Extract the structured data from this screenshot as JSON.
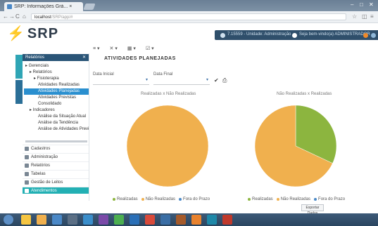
{
  "browser": {
    "tab_title": "SRP: Informações Grá... ×",
    "url_host": "localhost",
    "url_path": "/SRP/app/#",
    "nav": [
      "←",
      "→",
      "C",
      "⌂"
    ]
  },
  "app": {
    "logo_text": "SRP",
    "header_items": [
      "7.15559 - Unidade: Administração",
      "Seja bem-vindo(a) ADMINISTRADOR"
    ]
  },
  "sidebar": {
    "header": "Relatórios",
    "tree": [
      {
        "label": "Gerenciais",
        "indent": 0
      },
      {
        "label": "Relatórios",
        "indent": 1
      },
      {
        "label": "Fisioterapia",
        "indent": 2
      },
      {
        "label": "Atividades Realizadas",
        "indent": 3
      },
      {
        "label": "Atividades Planejadas",
        "indent": 3,
        "selected": true
      },
      {
        "label": "Atividades Previstas",
        "indent": 3
      },
      {
        "label": "Consolidado",
        "indent": 3
      },
      {
        "label": "Indicadores",
        "indent": 1
      },
      {
        "label": "Análise da Situação Atual",
        "indent": 3
      },
      {
        "label": "Análise da Tendência",
        "indent": 3
      },
      {
        "label": "Análise de Atividades Previstas",
        "indent": 3
      }
    ],
    "menu": [
      "Cadastros",
      "Administração",
      "Relatórios",
      "Tabelas",
      "Gestão de Leitos",
      "Atendimentos"
    ]
  },
  "toolbar": [
    "≡ ▾",
    "✕ ▾",
    "▦ ▾",
    "☑ ▾"
  ],
  "page": {
    "title": "ATIVIDADES PLANEJADAS",
    "filter1_label": "Data Inicial",
    "filter2_label": "Data Final",
    "chart1_title": "Realizadas x Não Realizadas",
    "chart2_title": "Não Realizadas x Realizadas",
    "button": "Exportar Dados"
  },
  "colors": {
    "orange": "#f0b04e",
    "green": "#8cb53f",
    "accent": "#2a5577",
    "teal": "#23b0b4"
  },
  "chart_data": [
    {
      "type": "pie",
      "title": "Realizadas x Não Realizadas",
      "slices": [
        {
          "name": "Realizadas",
          "value": 0
        },
        {
          "name": "Não Realizadas",
          "value": 100
        },
        {
          "name": "Fora do Prazo",
          "value": 0
        }
      ],
      "legend": [
        "Realizadas",
        "Não Realizadas",
        "Fora do Prazo"
      ],
      "legend_position": "bottom"
    },
    {
      "type": "pie",
      "title": "Não Realizadas x Realizadas",
      "slices": [
        {
          "name": "Realizadas",
          "value": 32
        },
        {
          "name": "Não Realizadas",
          "value": 68
        },
        {
          "name": "Fora do Prazo",
          "value": 0
        }
      ],
      "legend": [
        "Realizadas",
        "Não Realizadas",
        "Fora do Prazo"
      ],
      "legend_position": "bottom"
    }
  ]
}
